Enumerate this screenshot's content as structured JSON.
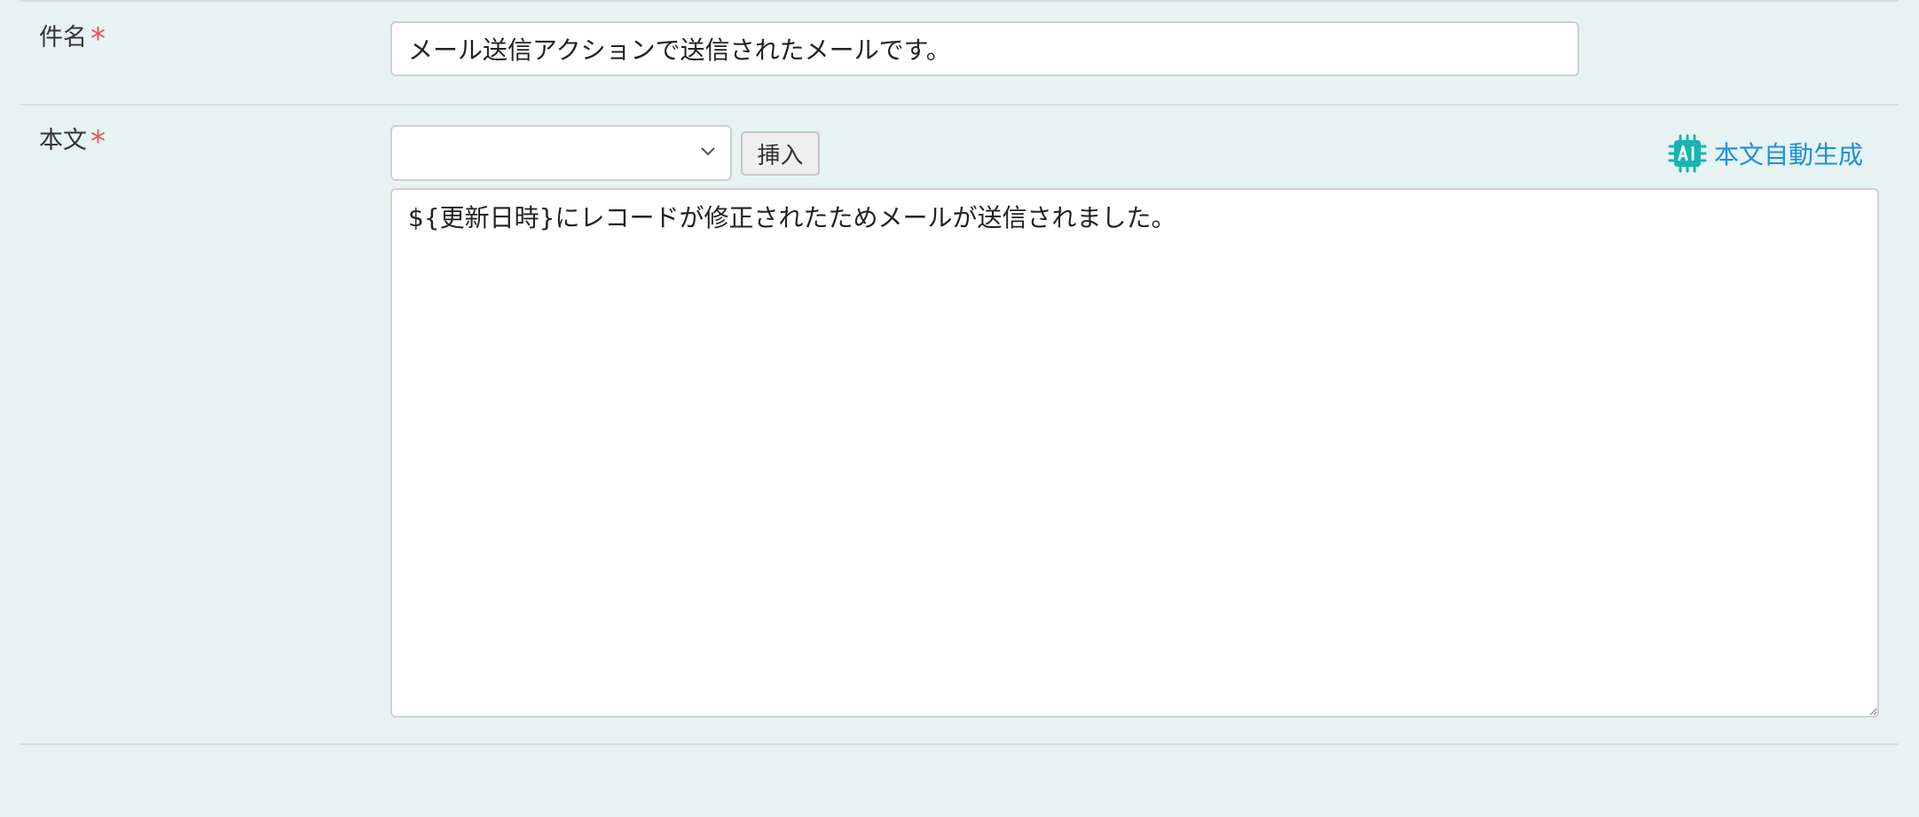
{
  "form": {
    "subject": {
      "label": "件名",
      "required_mark": "*",
      "value": "メール送信アクションで送信されたメールです。"
    },
    "body": {
      "label": "本文",
      "required_mark": "*",
      "insert_select_value": "",
      "insert_button_label": "挿入",
      "ai_generate_label": "本文自動生成",
      "ai_icon": "ai-chip-icon",
      "value": "${更新日時}にレコードが修正されたためメールが送信されました。"
    }
  },
  "colors": {
    "background": "#e7f3f3",
    "required": "#e05555",
    "link": "#1f8fe0",
    "ai_icon": "#19b3b3"
  }
}
